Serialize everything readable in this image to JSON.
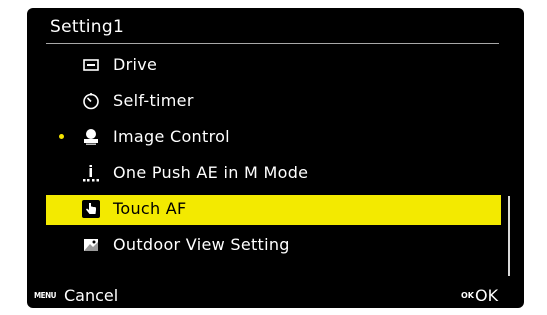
{
  "header": {
    "title": "Setting1"
  },
  "menu": {
    "items": [
      {
        "label": "Drive",
        "icon": "drive-icon",
        "selected": false,
        "marked": false
      },
      {
        "label": "Self-timer",
        "icon": "self-timer-icon",
        "selected": false,
        "marked": false
      },
      {
        "label": "Image Control",
        "icon": "image-control-icon",
        "selected": false,
        "marked": true
      },
      {
        "label": "One Push AE in M Mode",
        "icon": "one-push-ae-icon",
        "selected": false,
        "marked": false
      },
      {
        "label": "Touch AF",
        "icon": "touch-af-icon",
        "selected": true,
        "marked": false
      },
      {
        "label": "Outdoor View Setting",
        "icon": "outdoor-view-icon",
        "selected": false,
        "marked": false
      }
    ]
  },
  "footer": {
    "menu_key": "MENU",
    "cancel_label": "Cancel",
    "ok_key": "OK",
    "ok_label": "OK"
  },
  "colors": {
    "background": "#000000",
    "highlight": "#f3ea00",
    "marker": "#f5e400",
    "text": "#ffffff",
    "divider": "#a8a8a8"
  }
}
